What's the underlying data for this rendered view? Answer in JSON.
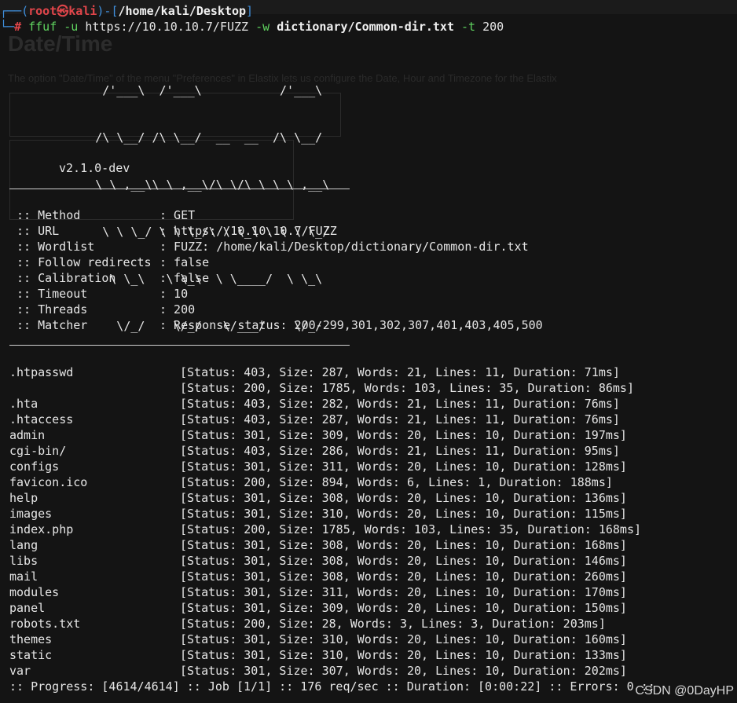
{
  "prompt": {
    "user": "root",
    "at": "㉿",
    "host": "kali",
    "path": "/home/kali/Desktop",
    "symbol": "#",
    "cmd": "ffuf",
    "flag_u": "-u",
    "url": "https://10.10.10.7/FUZZ",
    "flag_w": "-w",
    "wordlist": "dictionary/Common-dir.txt",
    "flag_t": "-t",
    "threads": "200"
  },
  "logo": {
    "lines": [
      "        /'___\\  /'___\\           /'___\\",
      "       /\\ \\__/ /\\ \\__/  __  __  /\\ \\__/",
      "       \\ \\ ,__\\\\ \\ ,__\\/\\ \\/\\ \\ \\ \\ ,__\\",
      "        \\ \\ \\_/ \\ \\ \\_/\\ \\ \\_\\ \\ \\ \\ \\_/",
      "         \\ \\_\\   \\ \\_\\  \\ \\____/  \\ \\_\\",
      "          \\/_/    \\/_/   \\/___/    \\/_/"
    ],
    "version": "v2.1.0-dev"
  },
  "config": [
    {
      "key": ":: Method",
      "value": ": GET"
    },
    {
      "key": ":: URL",
      "value": ": https://10.10.10.7/FUZZ"
    },
    {
      "key": ":: Wordlist",
      "value": ": FUZZ: /home/kali/Desktop/dictionary/Common-dir.txt"
    },
    {
      "key": ":: Follow redirects",
      "value": ": false"
    },
    {
      "key": ":: Calibration",
      "value": ": false"
    },
    {
      "key": ":: Timeout",
      "value": ": 10"
    },
    {
      "key": ":: Threads",
      "value": ": 200"
    },
    {
      "key": ":: Matcher",
      "value": ": Response status: 200-299,301,302,307,401,403,405,500"
    }
  ],
  "results": [
    {
      "name": ".htpasswd",
      "info": "[Status: 403, Size: 287, Words: 21, Lines: 11, Duration: 71ms]"
    },
    {
      "name": "",
      "info": "[Status: 200, Size: 1785, Words: 103, Lines: 35, Duration: 86ms]"
    },
    {
      "name": ".hta",
      "info": "[Status: 403, Size: 282, Words: 21, Lines: 11, Duration: 76ms]"
    },
    {
      "name": ".htaccess",
      "info": "[Status: 403, Size: 287, Words: 21, Lines: 11, Duration: 76ms]"
    },
    {
      "name": "admin",
      "info": "[Status: 301, Size: 309, Words: 20, Lines: 10, Duration: 197ms]"
    },
    {
      "name": "cgi-bin/",
      "info": "[Status: 403, Size: 286, Words: 21, Lines: 11, Duration: 95ms]"
    },
    {
      "name": "configs",
      "info": "[Status: 301, Size: 311, Words: 20, Lines: 10, Duration: 128ms]"
    },
    {
      "name": "favicon.ico",
      "info": "[Status: 200, Size: 894, Words: 6, Lines: 1, Duration: 188ms]"
    },
    {
      "name": "help",
      "info": "[Status: 301, Size: 308, Words: 20, Lines: 10, Duration: 136ms]"
    },
    {
      "name": "images",
      "info": "[Status: 301, Size: 310, Words: 20, Lines: 10, Duration: 115ms]"
    },
    {
      "name": "index.php",
      "info": "[Status: 200, Size: 1785, Words: 103, Lines: 35, Duration: 168ms]"
    },
    {
      "name": "lang",
      "info": "[Status: 301, Size: 308, Words: 20, Lines: 10, Duration: 168ms]"
    },
    {
      "name": "libs",
      "info": "[Status: 301, Size: 308, Words: 20, Lines: 10, Duration: 146ms]"
    },
    {
      "name": "mail",
      "info": "[Status: 301, Size: 308, Words: 20, Lines: 10, Duration: 260ms]"
    },
    {
      "name": "modules",
      "info": "[Status: 301, Size: 311, Words: 20, Lines: 10, Duration: 170ms]"
    },
    {
      "name": "panel",
      "info": "[Status: 301, Size: 309, Words: 20, Lines: 10, Duration: 150ms]"
    },
    {
      "name": "robots.txt",
      "info": "[Status: 200, Size: 28, Words: 3, Lines: 3, Duration: 203ms]"
    },
    {
      "name": "themes",
      "info": "[Status: 301, Size: 310, Words: 20, Lines: 10, Duration: 160ms]"
    },
    {
      "name": "static",
      "info": "[Status: 301, Size: 310, Words: 20, Lines: 10, Duration: 133ms]"
    },
    {
      "name": "var",
      "info": "[Status: 301, Size: 307, Words: 20, Lines: 10, Duration: 202ms]"
    }
  ],
  "progress": ":: Progress: [4614/4614] :: Job [1/1] :: 176 req/sec :: Duration: [0:00:22] :: Errors: 0 ::",
  "watermark": "CSDN @0DayHP",
  "background_ghost": {
    "heading": "Date/Time",
    "text": "The option \"Date/Time\" of the menu \"Preferences\" in Elastix lets us configure the Date, Hour and Timezone for the Elastix"
  },
  "colors": {
    "background": "#141414",
    "prompt_frame": "#3f8fdc",
    "prompt_user": "#e0454a",
    "command": "#5fd35f"
  }
}
